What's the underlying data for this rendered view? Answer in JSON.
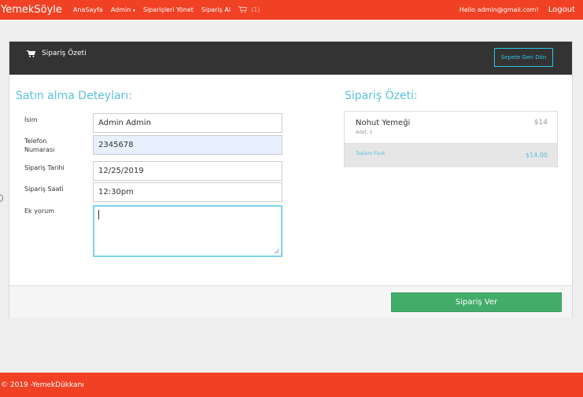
{
  "navbar": {
    "brand": "YemekSöyle",
    "links": [
      "AnaSayfa",
      "Admin",
      "Siparişleri Yönet",
      "Sipariş Al"
    ],
    "admin_caret": "▾",
    "cart_count": "(1)",
    "hello": "Hello admin@gmail.com!",
    "logout": "Logout"
  },
  "panel": {
    "title": "Sipariş Özeti",
    "back_button": "Sepete Geri Dön"
  },
  "form": {
    "title": "Satın alma Deteyları:",
    "fields": [
      {
        "label": "İsim",
        "value": "Admin Admin"
      },
      {
        "label": "Telefon Numarası",
        "value": "2345678"
      },
      {
        "label": "Sipariş Tarihi",
        "value": "12/25/2019"
      },
      {
        "label": "Sipariş Saati",
        "value": "12:30pm"
      },
      {
        "label": "Ek yorum",
        "value": ""
      }
    ]
  },
  "summary": {
    "title": "Sipariş Özeti:",
    "item_name": "Nohut Yemeği",
    "item_qty": "Adet: 1",
    "item_price": "$14",
    "total_label": "Toplam Fiyat",
    "total_value": "$14.00"
  },
  "order_button": "Sipariş Ver",
  "footer": "© 2019 -YemekDükkanı",
  "colors": {
    "brand_red": "#f04124",
    "header_dark": "#333333",
    "accent_blue": "#5bc0de",
    "button_green": "#43ac6a"
  },
  "icons": [
    "cart-icon",
    "caret-down-icon",
    "resize-grip-icon"
  ]
}
